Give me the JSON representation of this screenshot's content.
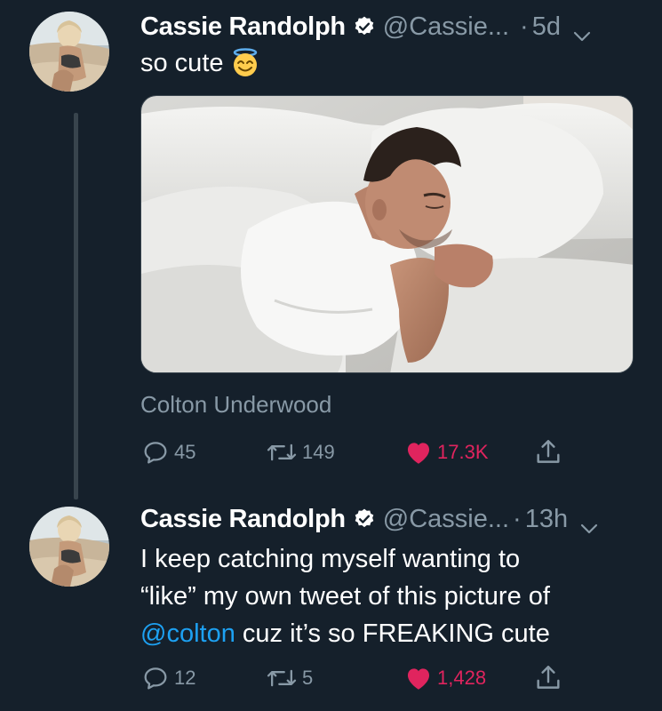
{
  "tweets": [
    {
      "name": "Cassie Randolph",
      "handle": "@Cassie...",
      "separator": "·",
      "time": "5d",
      "text": "so cute",
      "emoji": "smiling-face-with-halo",
      "media_caption": "Colton Underwood",
      "replies": "45",
      "retweets": "149",
      "likes": "17.3K",
      "liked": true
    },
    {
      "name": "Cassie Randolph",
      "handle": "@Cassie...",
      "separator": "·",
      "time": "13h",
      "text_line1": "I keep catching myself wanting to",
      "text_line2": "“like” my own tweet of this picture of",
      "mention": "@colton",
      "text_line3_rest": " cuz it’s so FREAKING cute",
      "replies": "12",
      "retweets": "5",
      "likes": "1,428",
      "liked": true
    }
  ],
  "colors": {
    "background": "#15202b",
    "secondary_text": "#8899a6",
    "link": "#1da1f2",
    "like": "#e0245e",
    "thread_line": "#38444d"
  },
  "icons": [
    "verified-badge-icon",
    "chevron-down-icon",
    "reply-icon",
    "retweet-icon",
    "heart-icon",
    "share-icon"
  ]
}
